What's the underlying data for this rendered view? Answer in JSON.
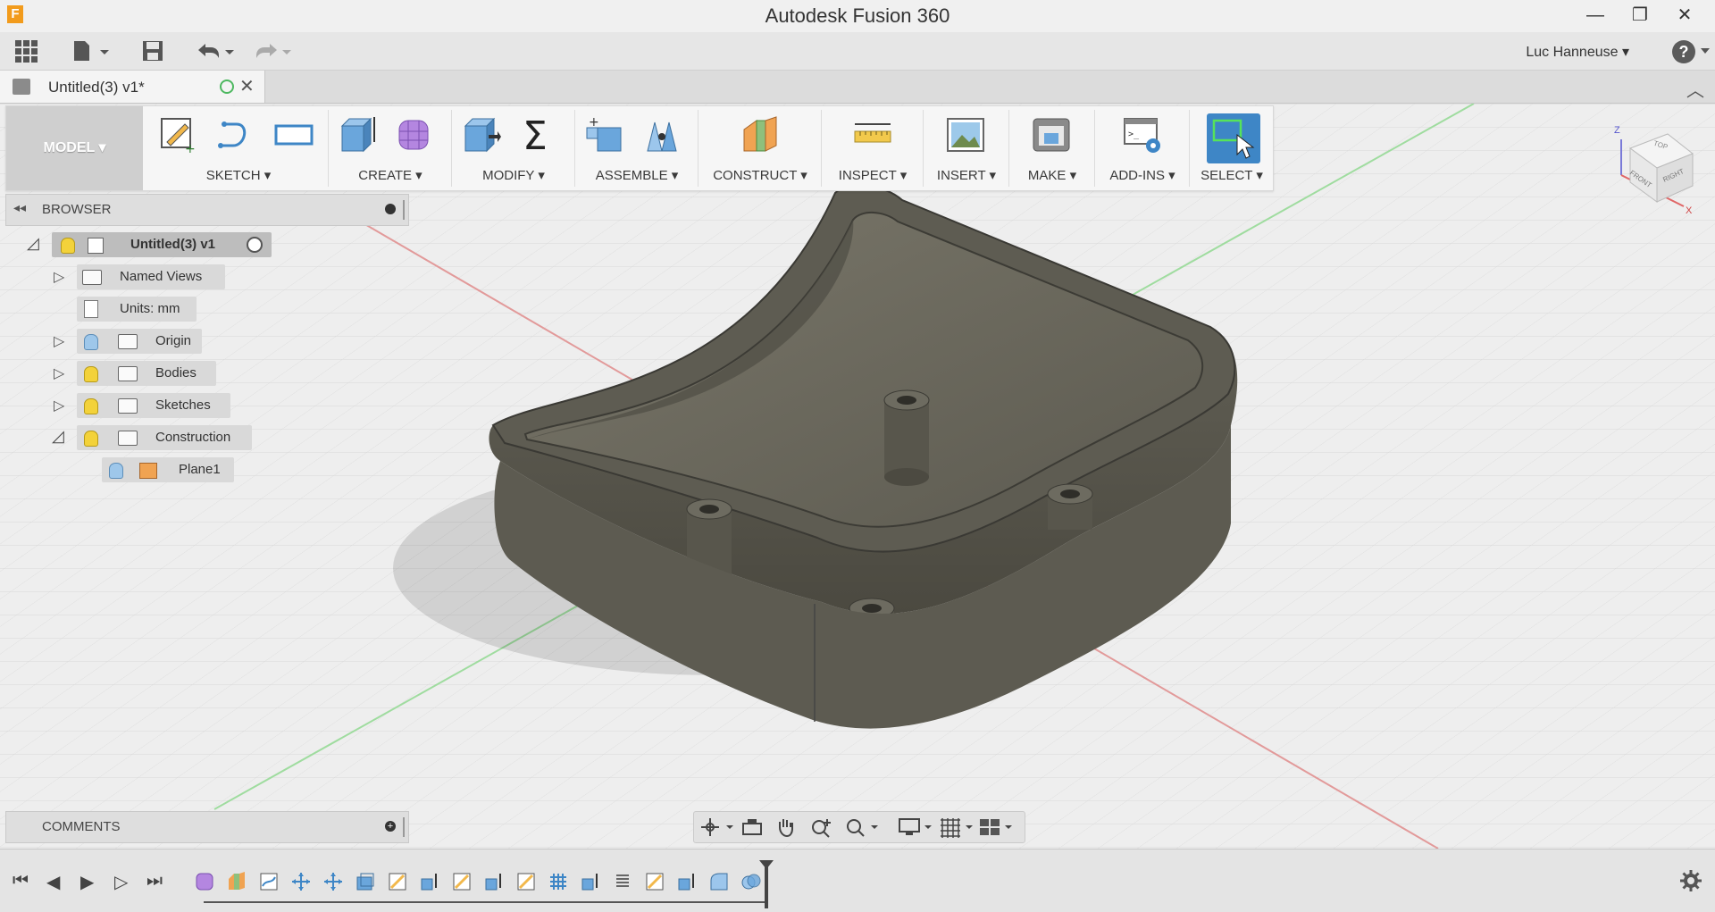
{
  "window": {
    "app_logo": "F",
    "title": "Autodesk Fusion 360",
    "minimize": "—",
    "restore": "❐",
    "close": "✕"
  },
  "quick_access": {
    "icons": [
      "apps-grid-icon",
      "file-icon",
      "save-icon",
      "undo-icon",
      "redo-icon"
    ],
    "user": "Luc Hanneuse ▾",
    "help": "?"
  },
  "document_tab": {
    "label": "Untitled(3) v1*"
  },
  "ribbon": {
    "workspace": "MODEL ▾",
    "groups": [
      {
        "label": "SKETCH ▾"
      },
      {
        "label": "CREATE ▾"
      },
      {
        "label": "MODIFY ▾"
      },
      {
        "label": "ASSEMBLE ▾"
      },
      {
        "label": "CONSTRUCT ▾"
      },
      {
        "label": "INSPECT ▾"
      },
      {
        "label": "INSERT ▾"
      },
      {
        "label": "MAKE ▾"
      },
      {
        "label": "ADD-INS ▾"
      },
      {
        "label": "SELECT ▾"
      }
    ]
  },
  "browser": {
    "title": "BROWSER",
    "tree": {
      "root": "Untitled(3) v1",
      "named_views": "Named Views",
      "units": "Units: mm",
      "origin": "Origin",
      "bodies": "Bodies",
      "sketches": "Sketches",
      "construction": "Construction",
      "plane": "Plane1"
    }
  },
  "comments": {
    "title": "COMMENTS"
  },
  "viewcube": {
    "top": "TOP",
    "front": "FRONT",
    "right": "RIGHT",
    "axis_z": "Z",
    "axis_x": "X"
  },
  "colors": {
    "accent_select": "#3e86c6",
    "model_surface": "#55534a",
    "axis_red": "#e05a5a",
    "axis_green": "#6ccf6c",
    "bulb_on": "#f3d23a",
    "bulb_off": "#9ec7ea"
  }
}
